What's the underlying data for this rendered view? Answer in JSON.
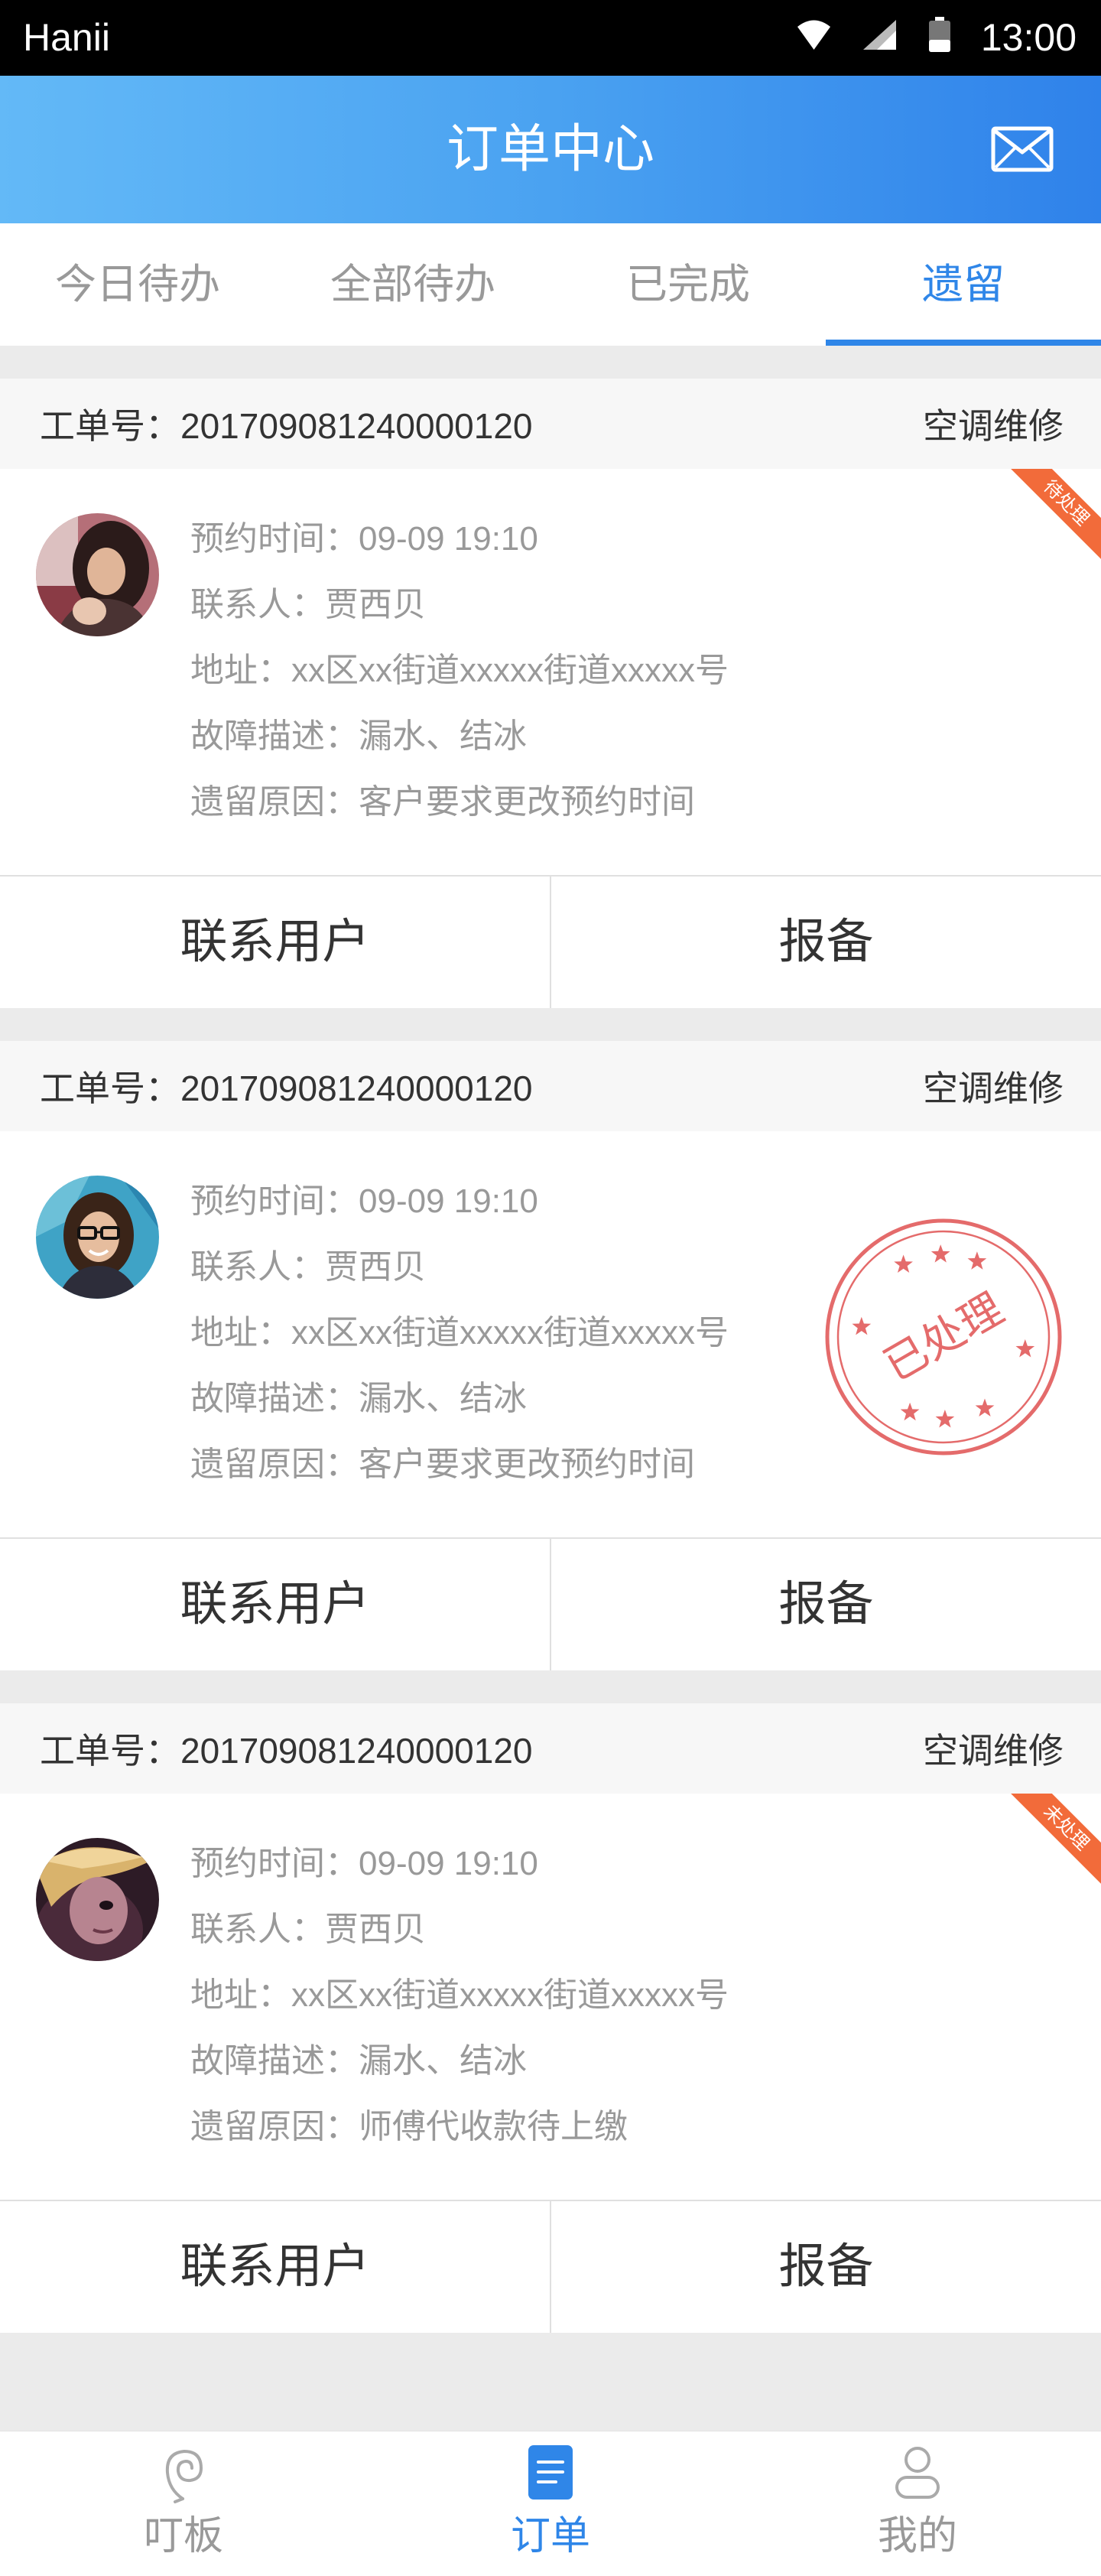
{
  "status_bar": {
    "carrier": "Hanii",
    "time": "13:00",
    "icons": [
      "wifi-icon",
      "signal-icon",
      "battery-icon"
    ]
  },
  "header": {
    "title": "订单中心",
    "action_icon": "mail-icon"
  },
  "tabs": [
    {
      "label": "今日待办",
      "active": false
    },
    {
      "label": "全部待办",
      "active": false
    },
    {
      "label": "已完成",
      "active": false
    },
    {
      "label": "遗留",
      "active": true
    }
  ],
  "orders": [
    {
      "order_no_label": "工单号：",
      "order_no": "201709081240000120",
      "category": "空调维修",
      "fields": [
        {
          "label": "预约时间：",
          "value": "09-09 19:10"
        },
        {
          "label": "联系人：",
          "value": "贾西贝"
        },
        {
          "label": "地址：",
          "value": "xx区xx街道xxxxx街道xxxxx号"
        },
        {
          "label": "故障描述：",
          "value": "漏水、结冰"
        },
        {
          "label": "遗留原因：",
          "value": "客户要求更改预约时间"
        }
      ],
      "ribbon_text": "待处理",
      "actions": {
        "contact": "联系用户",
        "report": "报备"
      }
    },
    {
      "order_no_label": "工单号：",
      "order_no": "201709081240000120",
      "category": "空调维修",
      "fields": [
        {
          "label": "预约时间：",
          "value": "09-09 19:10"
        },
        {
          "label": "联系人：",
          "value": "贾西贝"
        },
        {
          "label": "地址：",
          "value": "xx区xx街道xxxxx街道xxxxx号"
        },
        {
          "label": "故障描述：",
          "value": "漏水、结冰"
        },
        {
          "label": "遗留原因：",
          "value": "客户要求更改预约时间"
        }
      ],
      "stamp_text": "已处理",
      "actions": {
        "contact": "联系用户",
        "report": "报备"
      }
    },
    {
      "order_no_label": "工单号：",
      "order_no": "201709081240000120",
      "category": "空调维修",
      "fields": [
        {
          "label": "预约时间：",
          "value": "09-09 19:10"
        },
        {
          "label": "联系人：",
          "value": "贾西贝"
        },
        {
          "label": "地址：",
          "value": "xx区xx街道xxxxx街道xxxxx号"
        },
        {
          "label": "故障描述：",
          "value": "漏水、结冰"
        },
        {
          "label": "遗留原因：",
          "value": "师傅代收款待上缴"
        }
      ],
      "ribbon_text": "未处理",
      "actions": {
        "contact": "联系用户",
        "report": "报备"
      }
    }
  ],
  "bottom_nav": [
    {
      "label": "叮板",
      "icon": "dingban-icon",
      "active": false
    },
    {
      "label": "订单",
      "icon": "order-document-icon",
      "active": true
    },
    {
      "label": "我的",
      "icon": "profile-icon",
      "active": false
    }
  ],
  "colors": {
    "accent": "#2f86e8",
    "header_gradient_start": "#63b9f7",
    "header_gradient_end": "#2f82ea",
    "ribbon": "#f26b3a",
    "stamp": "#e25c5c",
    "muted_text": "#999999",
    "page_background": "#ebebeb"
  }
}
